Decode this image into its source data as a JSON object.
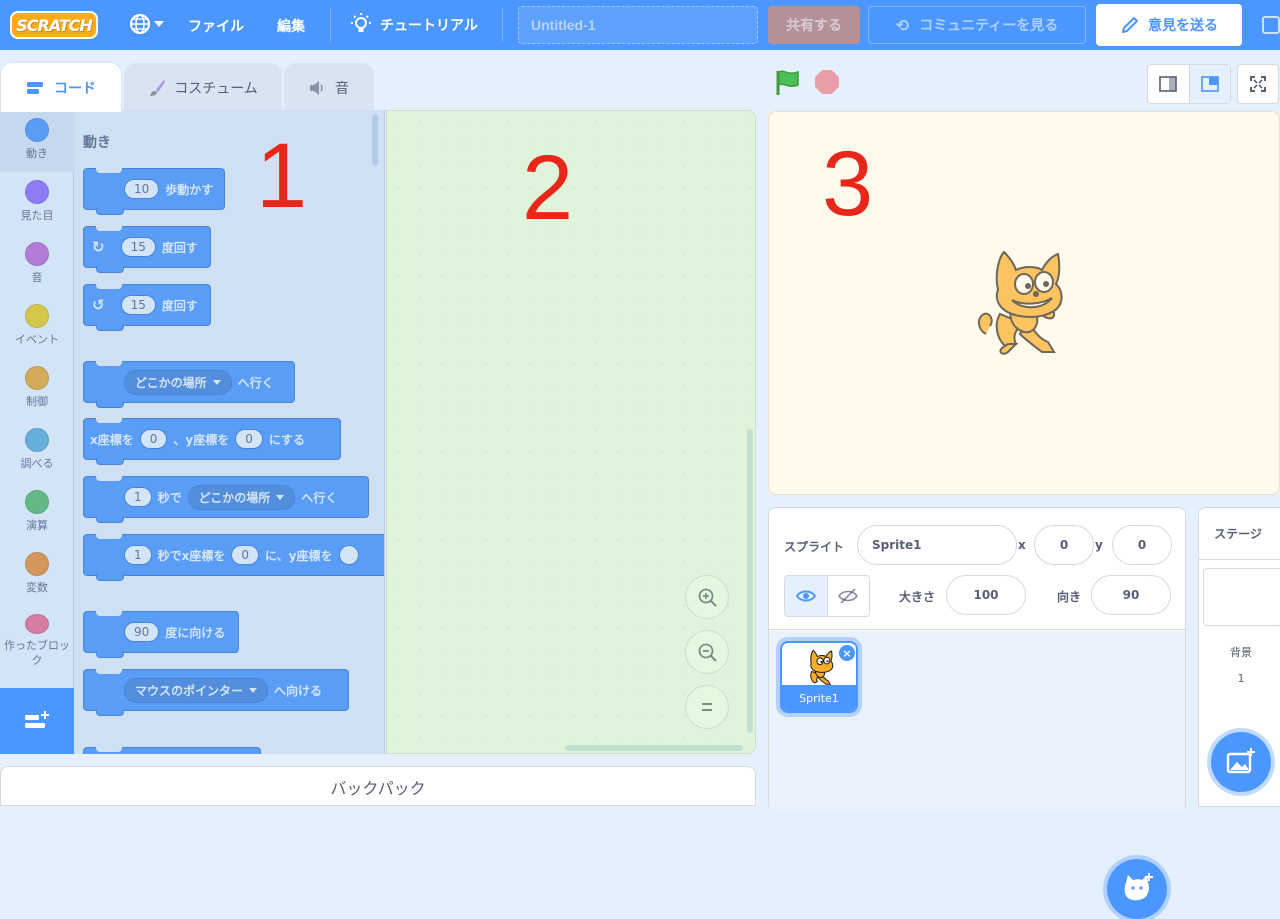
{
  "menubar": {
    "logo": "SCRATCH",
    "file": "ファイル",
    "edit": "編集",
    "tutorial": "チュートリアル",
    "project_title": "Untitled-1",
    "share": "共有する",
    "community": "コミュニティーを見る",
    "feedback": "意見を送る"
  },
  "tabs": {
    "code": "コード",
    "costumes": "コスチューム",
    "sounds": "音"
  },
  "categories": [
    {
      "label": "動き",
      "color": "#4c97ff"
    },
    {
      "label": "見た目",
      "color": "#9966ff"
    },
    {
      "label": "音",
      "color": "#cf63cf"
    },
    {
      "label": "イベント",
      "color": "#ffd500"
    },
    {
      "label": "制御",
      "color": "#ffab19"
    },
    {
      "label": "調べる",
      "color": "#5cb1d6"
    },
    {
      "label": "演算",
      "color": "#59c059"
    },
    {
      "label": "変数",
      "color": "#ff8c1a"
    },
    {
      "label": "作ったブロック",
      "color": "#ff6680"
    }
  ],
  "palette": {
    "title": "動き",
    "move_steps": "10",
    "move_label": "歩動かす",
    "turn_right_deg": "15",
    "turn_right_label": "度回す",
    "turn_left_deg": "15",
    "turn_left_label": "度回す",
    "goto_target": "どこかの場所",
    "goto_label": "へ行く",
    "gotoxy_x_label": "x座標を",
    "gotoxy_x": "0",
    "gotoxy_y_label": "、y座標を",
    "gotoxy_y": "0",
    "gotoxy_suffix": "にする",
    "glide_secs": "1",
    "glide_label": "秒で",
    "glide_target": "どこかの場所",
    "glide_suffix": "へ行く",
    "glidexy_secs": "1",
    "glidexy_label": "秒でx座標を",
    "glidexy_x": "0",
    "glidexy_mid": "に、y座標を",
    "point_dir": "90",
    "point_label": "度に向ける",
    "point_towards_target": "マウスのポインター",
    "point_towards_label": "へ向ける"
  },
  "overlay_labels": {
    "area1": "1",
    "area2": "2",
    "area3": "3"
  },
  "backpack": "バックパック",
  "sprite_info": {
    "sprite_label": "スプライト",
    "sprite_name": "Sprite1",
    "x_label": "x",
    "x": "0",
    "y_label": "y",
    "y": "0",
    "size_label": "大きさ",
    "size": "100",
    "direction_label": "向き",
    "direction": "90"
  },
  "sprites": [
    {
      "name": "Sprite1"
    }
  ],
  "stage_pane": {
    "title": "ステージ",
    "backdrops_label": "背景",
    "backdrops_count": "1"
  }
}
